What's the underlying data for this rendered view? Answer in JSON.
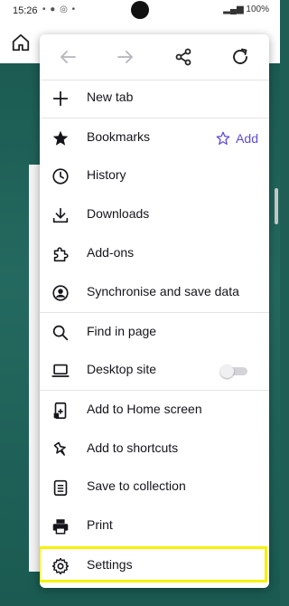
{
  "status_bar": {
    "time": "15:26",
    "notifications": "• ● ◎ •",
    "battery": "100%"
  },
  "menu": {
    "items": [
      {
        "label": "New tab",
        "icon": "plus-icon"
      },
      {
        "label": "Bookmarks",
        "icon": "star-filled-icon"
      },
      {
        "label": "History",
        "icon": "clock-icon"
      },
      {
        "label": "Downloads",
        "icon": "download-icon"
      },
      {
        "label": "Add-ons",
        "icon": "puzzle-icon"
      },
      {
        "label": "Synchronise and save data",
        "icon": "account-icon"
      },
      {
        "label": "Find in page",
        "icon": "search-icon"
      },
      {
        "label": "Desktop site",
        "icon": "laptop-icon"
      },
      {
        "label": "Add to Home screen",
        "icon": "add-to-phone-icon"
      },
      {
        "label": "Add to shortcuts",
        "icon": "pin-icon"
      },
      {
        "label": "Save to collection",
        "icon": "collection-icon"
      },
      {
        "label": "Print",
        "icon": "printer-icon"
      },
      {
        "label": "Settings",
        "icon": "gear-icon"
      }
    ],
    "bookmark_add_label": "Add",
    "desktop_site_enabled": false
  },
  "colors": {
    "accent": "#5b4bd6",
    "highlight": "#f5f200",
    "page_background": "#1f5e55"
  }
}
